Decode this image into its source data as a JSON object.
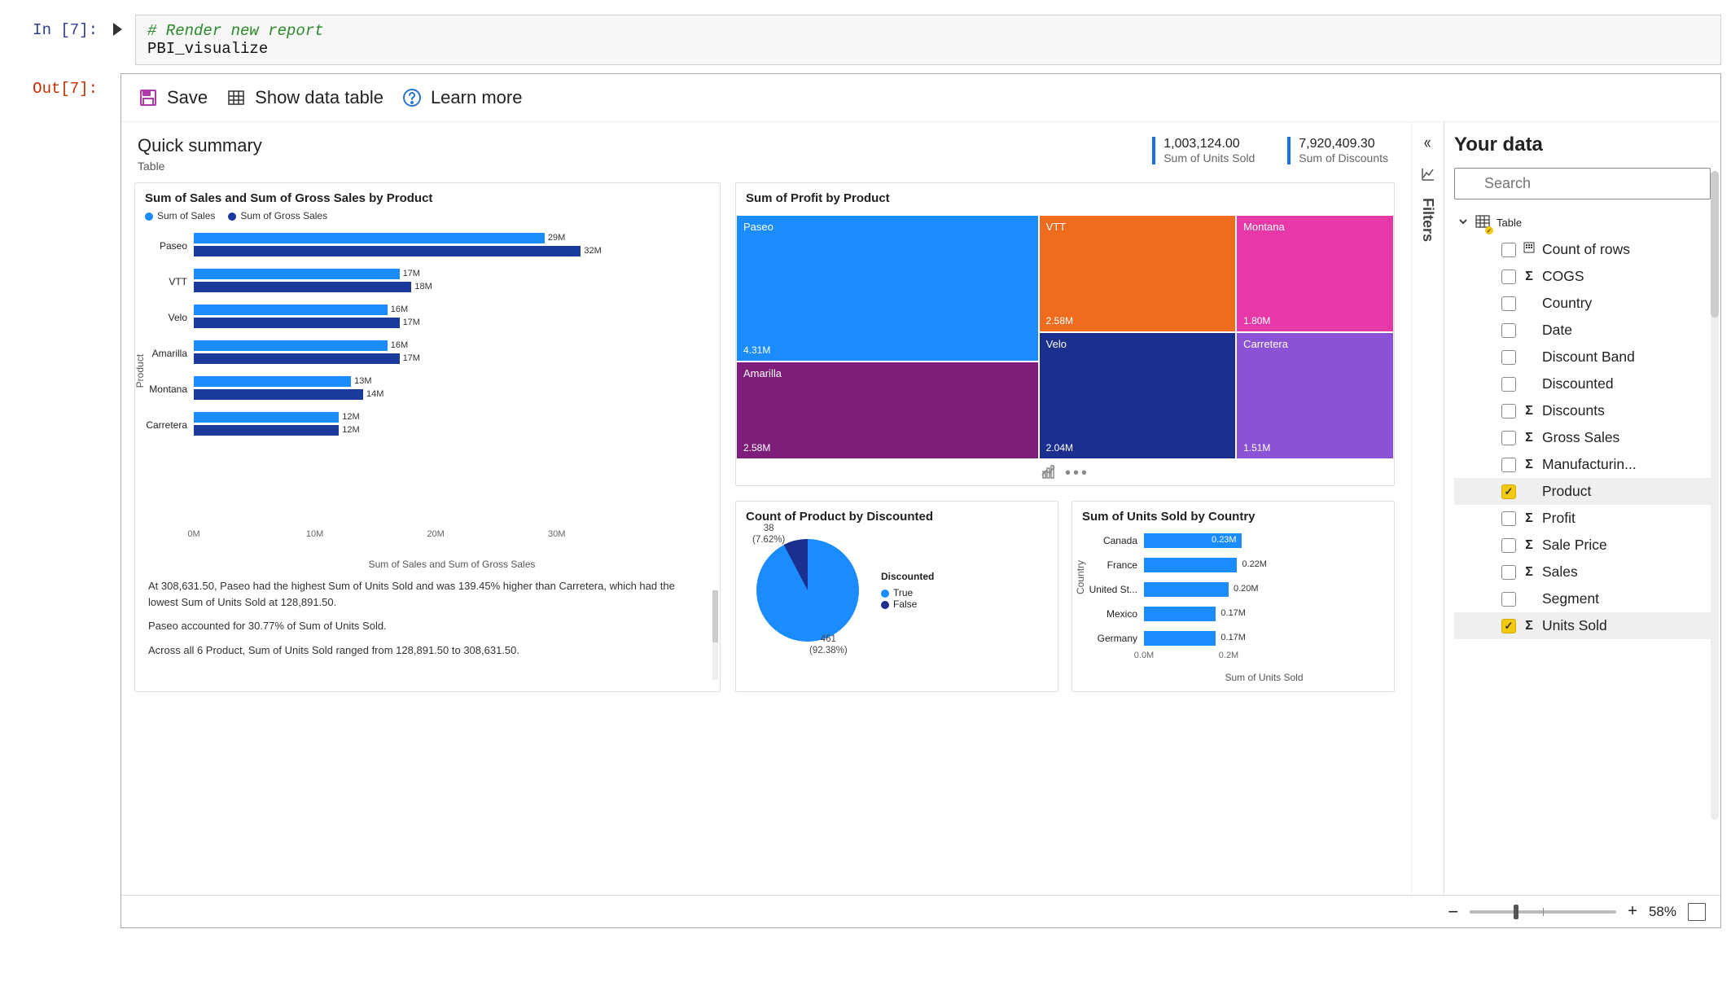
{
  "cell": {
    "in_prompt": "In [7]:",
    "out_prompt": "Out[7]:",
    "comment": "# Render new report",
    "code": "PBI_visualize"
  },
  "toolbar": {
    "save": "Save",
    "show_table": "Show data table",
    "learn_more": "Learn more"
  },
  "summary": {
    "title": "Quick summary",
    "subtitle": "Table",
    "kpis": [
      {
        "value": "1,003,124.00",
        "label": "Sum of Units Sold"
      },
      {
        "value": "7,920,409.30",
        "label": "Sum of Discounts"
      }
    ]
  },
  "side_tabs": {
    "filters": "Filters"
  },
  "fields_panel": {
    "title": "Your data",
    "search_placeholder": "Search",
    "table_label": "Table",
    "fields": [
      {
        "name": "Count of rows",
        "sigma": false,
        "icon": "hash",
        "checked": false,
        "selected": false
      },
      {
        "name": "COGS",
        "sigma": true,
        "checked": false,
        "selected": false
      },
      {
        "name": "Country",
        "sigma": false,
        "checked": false,
        "selected": false
      },
      {
        "name": "Date",
        "sigma": false,
        "checked": false,
        "selected": false
      },
      {
        "name": "Discount Band",
        "sigma": false,
        "checked": false,
        "selected": false
      },
      {
        "name": "Discounted",
        "sigma": false,
        "checked": false,
        "selected": false
      },
      {
        "name": "Discounts",
        "sigma": true,
        "checked": false,
        "selected": false
      },
      {
        "name": "Gross Sales",
        "sigma": true,
        "checked": false,
        "selected": false
      },
      {
        "name": "Manufacturin...",
        "sigma": true,
        "checked": false,
        "selected": false
      },
      {
        "name": "Product",
        "sigma": false,
        "checked": true,
        "selected": true
      },
      {
        "name": "Profit",
        "sigma": true,
        "checked": false,
        "selected": false
      },
      {
        "name": "Sale Price",
        "sigma": true,
        "checked": false,
        "selected": false
      },
      {
        "name": "Sales",
        "sigma": true,
        "checked": false,
        "selected": false
      },
      {
        "name": "Segment",
        "sigma": false,
        "checked": false,
        "selected": false
      },
      {
        "name": "Units Sold",
        "sigma": true,
        "checked": true,
        "selected": true
      }
    ]
  },
  "chart_data": [
    {
      "id": "sales_gross_by_product",
      "type": "bar",
      "orientation": "horizontal",
      "title": "Sum of Sales and Sum of Gross Sales by Product",
      "xlabel": "Sum of Sales and Sum of Gross Sales",
      "ylabel": "Product",
      "series_names": [
        "Sum of Sales",
        "Sum of Gross Sales"
      ],
      "series_colors": [
        "#1a8cff",
        "#1b3a9e"
      ],
      "categories": [
        "Paseo",
        "VTT",
        "Velo",
        "Amarilla",
        "Montana",
        "Carretera"
      ],
      "series": [
        {
          "name": "Sum of Sales",
          "values": [
            29,
            17,
            16,
            16,
            13,
            12
          ],
          "labels": [
            "29M",
            "17M",
            "16M",
            "16M",
            "13M",
            "12M"
          ]
        },
        {
          "name": "Sum of Gross Sales",
          "values": [
            32,
            18,
            17,
            17,
            14,
            12
          ],
          "labels": [
            "32M",
            "18M",
            "17M",
            "17M",
            "14M",
            "12M"
          ]
        }
      ],
      "xticks": [
        "0M",
        "10M",
        "20M",
        "30M"
      ],
      "xlim": [
        0,
        35
      ]
    },
    {
      "id": "profit_by_product",
      "type": "treemap",
      "title": "Sum of Profit by Product",
      "items": [
        {
          "name": "Paseo",
          "value": 4.31,
          "label": "4.31M",
          "color": "#1a8cff"
        },
        {
          "name": "VTT",
          "value": 2.58,
          "label": "2.58M",
          "color": "#ef6c1f"
        },
        {
          "name": "Amarilla",
          "value": 2.58,
          "label": "2.58M",
          "color": "#7d1e7a"
        },
        {
          "name": "Velo",
          "value": 2.04,
          "label": "2.04M",
          "color": "#1b2f8e"
        },
        {
          "name": "Montana",
          "value": 1.8,
          "label": "1.80M",
          "color": "#e638a6"
        },
        {
          "name": "Carretera",
          "value": 1.51,
          "label": "1.51M",
          "color": "#8c52d6"
        }
      ]
    },
    {
      "id": "count_by_discounted",
      "type": "pie",
      "title": "Count of Product by Discounted",
      "legend_title": "Discounted",
      "slices": [
        {
          "name": "True",
          "value": 461,
          "pct": "92.38%",
          "color": "#1a8cff"
        },
        {
          "name": "False",
          "value": 38,
          "pct": "7.62%",
          "color": "#1b2f8e"
        }
      ],
      "labels": {
        "top": "38\n(7.62%)",
        "bottom": "461\n(92.38%)"
      }
    },
    {
      "id": "units_by_country",
      "type": "bar",
      "orientation": "horizontal",
      "title": "Sum of Units Sold by Country",
      "xlabel": "Sum of Units Sold",
      "ylabel": "Country",
      "categories": [
        "Canada",
        "France",
        "United St...",
        "Mexico",
        "Germany"
      ],
      "values": [
        0.23,
        0.22,
        0.2,
        0.17,
        0.17
      ],
      "value_labels": [
        "0.23M",
        "0.22M",
        "0.20M",
        "0.17M",
        "0.17M"
      ],
      "xticks": [
        "0.0M",
        "0.2M"
      ],
      "xlim": [
        0,
        0.25
      ],
      "color": "#1a8cff"
    }
  ],
  "insights": {
    "p1": "At 308,631.50,  Paseo had the highest Sum of Units Sold and was 139.45% higher than  Carretera, which had the lowest Sum of Units Sold at 128,891.50.",
    "p2": " Paseo accounted for 30.77% of Sum of Units Sold.",
    "p3": "Across all 6 Product, Sum of Units Sold ranged from 128,891.50 to 308,631.50."
  },
  "footer": {
    "zoom": "58%",
    "minus": "−",
    "plus": "+"
  }
}
